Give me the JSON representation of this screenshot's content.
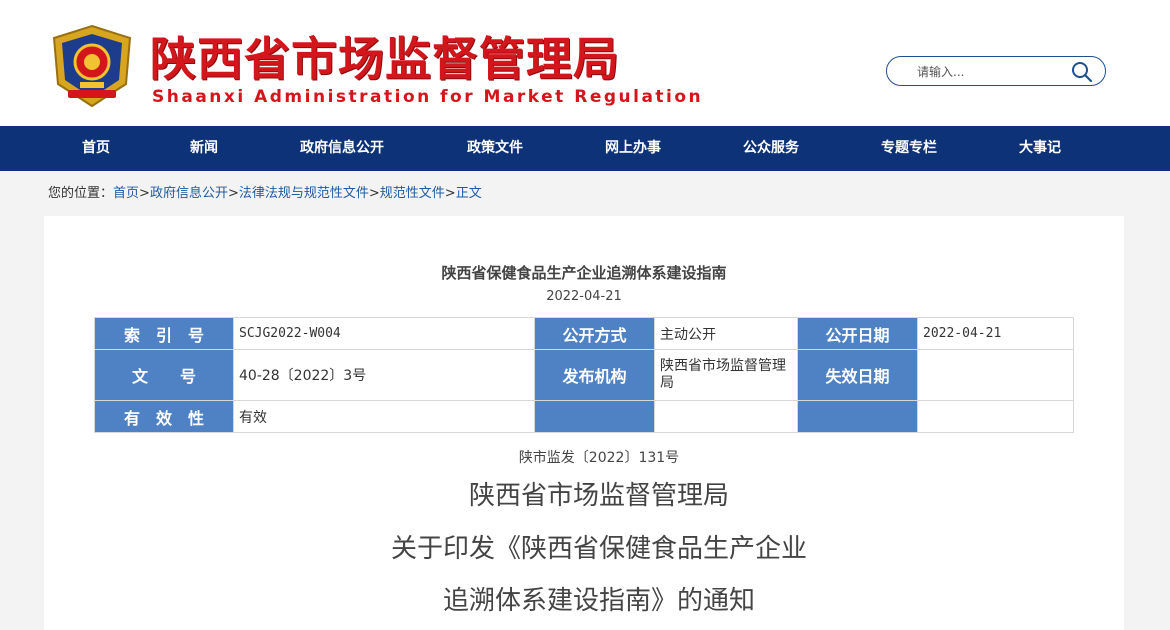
{
  "header": {
    "title": "陕西省市场监督管理局",
    "subtitle": "Shaanxi Administration for Market Regulation",
    "emblem_icon": "police-emblem-icon",
    "search": {
      "placeholder": "请输入...",
      "icon": "search-icon"
    },
    "colors": {
      "title": "#d3161b",
      "nav": "#0e3277",
      "label_cell": "#4f82c4"
    }
  },
  "nav": {
    "items": [
      {
        "label": "首页"
      },
      {
        "label": "新闻"
      },
      {
        "label": "政府信息公开"
      },
      {
        "label": "政策文件"
      },
      {
        "label": "网上办事"
      },
      {
        "label": "公众服务"
      },
      {
        "label": "专题专栏"
      },
      {
        "label": "大事记"
      }
    ]
  },
  "breadcrumb": {
    "prefix": "您的位置：",
    "items": [
      "首页",
      "政府信息公开",
      "法律法规与规范性文件",
      "规范性文件",
      "正文"
    ],
    "separator": ">"
  },
  "article": {
    "title": "陕西省保健食品生产企业追溯体系建设指南",
    "date": "2022-04-21",
    "meta": {
      "index_label": "索　引　号",
      "index_value": "SCJG2022-W004",
      "publish_mode_label": "公开方式",
      "publish_mode_value": "主动公开",
      "publish_date_label": "公开日期",
      "publish_date_value": "2022-04-21",
      "doc_label": "文　　号",
      "doc_value": "40-28〔2022〕3号",
      "issuer_label": "发布机构",
      "issuer_value": "陕西省市场监督管理局",
      "expiry_label": "失效日期",
      "expiry_value": "",
      "validity_label": "有　效　性",
      "validity_value": "有效"
    },
    "doc_number": "陕市监发〔2022〕131号",
    "heading_lines": [
      "陕西省市场监督管理局",
      "关于印发《陕西省保健食品生产企业",
      "追溯体系建设指南》的通知"
    ]
  }
}
